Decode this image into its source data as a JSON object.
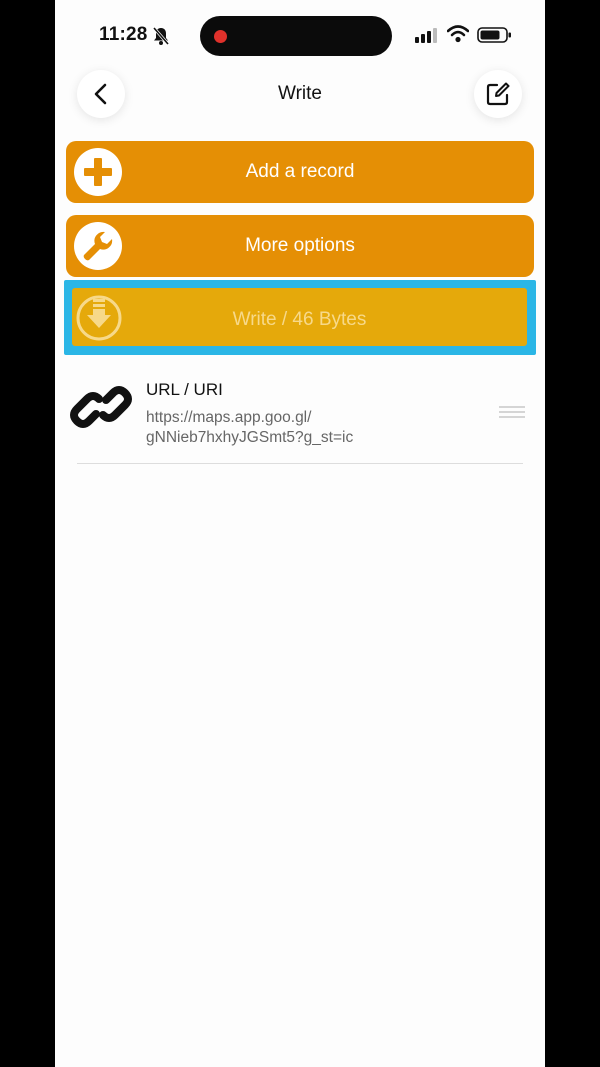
{
  "status_bar": {
    "time": "11:28",
    "icons": [
      "bell-slash-icon",
      "signal-icon",
      "wifi-icon",
      "battery-icon"
    ]
  },
  "nav": {
    "title": "Write",
    "back_icon": "chevron-left-icon",
    "edit_icon": "compose-icon"
  },
  "actions": {
    "add_record": {
      "label": "Add a record",
      "icon": "plus-circle-icon"
    },
    "more_options": {
      "label": "More options",
      "icon": "wrench-circle-icon"
    },
    "write": {
      "label": "Write / 46 Bytes",
      "icon": "download-circle-icon"
    }
  },
  "records": [
    {
      "type": "URL / URI",
      "value_line1": "https://maps.app.goo.gl/",
      "value_line2": "gNNieb7hxhyJGSmt5?g_st=ic",
      "icon": "link-icon"
    }
  ],
  "colors": {
    "action_orange": "#e58f05",
    "write_yellow": "#e5a90b",
    "highlight_blue": "#2bb6e6",
    "record_dot": "#e0312b"
  }
}
